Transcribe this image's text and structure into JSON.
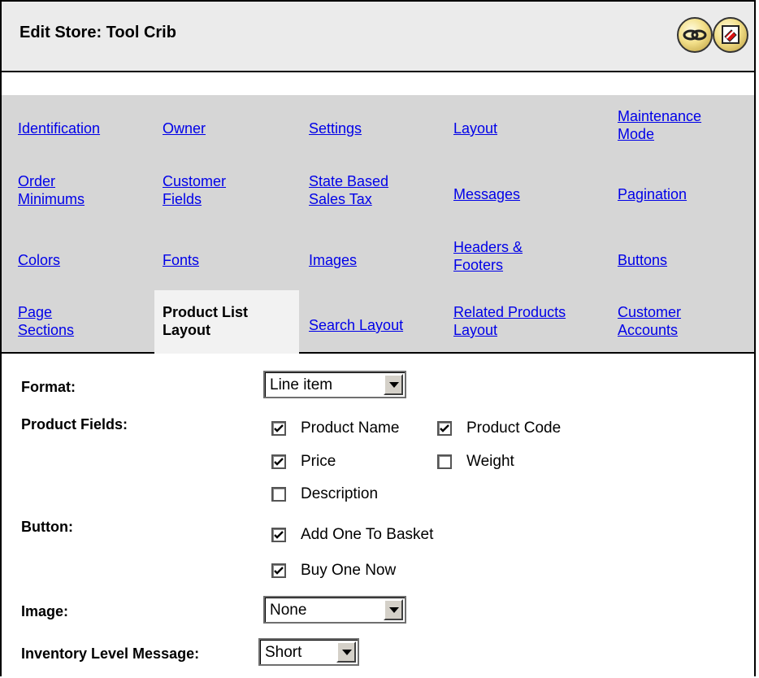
{
  "window": {
    "title": "Edit Store: Tool Crib"
  },
  "toolbar": {
    "icons": [
      "link-icon",
      "close-icon"
    ]
  },
  "tabs": [
    {
      "label": "Identification"
    },
    {
      "label": "Owner"
    },
    {
      "label": "Settings"
    },
    {
      "label": "Layout"
    },
    {
      "label": "Maintenance Mode"
    },
    {
      "label": "Order Minimums"
    },
    {
      "label": "Customer Fields"
    },
    {
      "label": "State Based Sales Tax"
    },
    {
      "label": "Messages"
    },
    {
      "label": "Pagination"
    },
    {
      "label": "Colors"
    },
    {
      "label": "Fonts"
    },
    {
      "label": "Images"
    },
    {
      "label": "Headers & Footers"
    },
    {
      "label": "Buttons"
    },
    {
      "label": "Page Sections"
    },
    {
      "label": "Product List Layout",
      "active": true
    },
    {
      "label": "Search Layout"
    },
    {
      "label": "Related Products Layout"
    },
    {
      "label": "Customer Accounts"
    }
  ],
  "form": {
    "format": {
      "label": "Format:",
      "value": "Line item"
    },
    "product_fields": {
      "label": "Product Fields:",
      "options": [
        {
          "label": "Product Name",
          "checked": true
        },
        {
          "label": "Product Code",
          "checked": true
        },
        {
          "label": "Price",
          "checked": true
        },
        {
          "label": "Weight",
          "checked": false
        },
        {
          "label": "Description",
          "checked": false
        }
      ]
    },
    "button": {
      "label": "Button:",
      "options": [
        {
          "label": "Add One To Basket",
          "checked": true
        },
        {
          "label": "Buy One Now",
          "checked": true
        }
      ]
    },
    "image": {
      "label": "Image:",
      "value": "None"
    },
    "inventory": {
      "label": "Inventory Level Message:",
      "value": "Short"
    }
  }
}
